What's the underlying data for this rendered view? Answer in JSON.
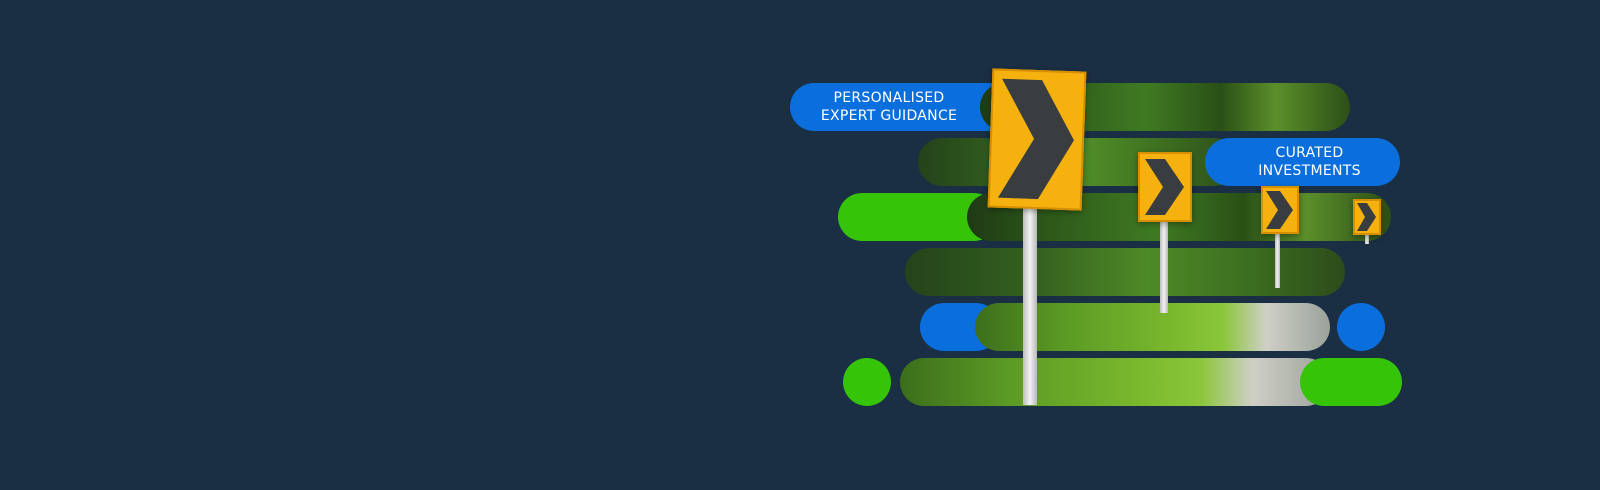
{
  "banner": {
    "background_color": "#1a2e44",
    "accent_blue": "#0a6fdc",
    "accent_green": "#35c408"
  },
  "labels": {
    "guidance": [
      "PERSONALISED",
      "EXPERT GUIDANCE"
    ],
    "investments": [
      "CURATED",
      "INVESTMENTS"
    ]
  },
  "icons": {
    "sign": "chevron-right-icon"
  }
}
